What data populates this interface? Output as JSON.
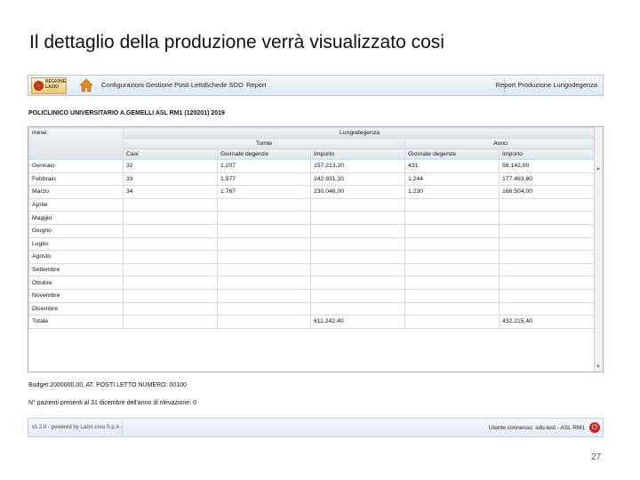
{
  "slide": {
    "title": "Il dettaglio della produzione verrà visualizzato cosi",
    "page_number": "27"
  },
  "app": {
    "logo_text": "REGIONE LAZIO",
    "menu": [
      "Configurazioni",
      "Gestione Posti Letto",
      "Schede SDO",
      "Report"
    ],
    "report_title": "Report Produzione Lungodegenza"
  },
  "hospital_header": "POLICLINICO UNIVERSITARIO A.GEMELLI ASL RM1 (120201) 2019",
  "table": {
    "col_mese": "mese",
    "group_title": "Lungodegenza",
    "sub_tomie": "Tomie",
    "sub_anno": "Anno",
    "headers": [
      "Casi",
      "Giornate degenze",
      "Importo",
      "Giornate degenze",
      "Importo"
    ],
    "rows": [
      {
        "mese": "Gennaio",
        "casi": "32",
        "gg1": "1.207",
        "imp1": "157.213,20",
        "gg2": "431",
        "imp2": "56.142,00"
      },
      {
        "mese": "Febbraio",
        "casi": "33",
        "gg1": "1.577",
        "imp1": "242.931,20",
        "gg2": "1.244",
        "imp2": "177.463,80"
      },
      {
        "mese": "Marzo",
        "casi": "34",
        "gg1": "1.767",
        "imp1": "230.046,00",
        "gg2": "1.230",
        "imp2": "166.504,00"
      },
      {
        "mese": "Aprile",
        "casi": "",
        "gg1": "",
        "imp1": "",
        "gg2": "",
        "imp2": ""
      },
      {
        "mese": "Maggio",
        "casi": "",
        "gg1": "",
        "imp1": "",
        "gg2": "",
        "imp2": ""
      },
      {
        "mese": "Giugno",
        "casi": "",
        "gg1": "",
        "imp1": "",
        "gg2": "",
        "imp2": ""
      },
      {
        "mese": "Luglio",
        "casi": "",
        "gg1": "",
        "imp1": "",
        "gg2": "",
        "imp2": ""
      },
      {
        "mese": "Agosto",
        "casi": "",
        "gg1": "",
        "imp1": "",
        "gg2": "",
        "imp2": ""
      },
      {
        "mese": "Settembre",
        "casi": "",
        "gg1": "",
        "imp1": "",
        "gg2": "",
        "imp2": ""
      },
      {
        "mese": "Ottobre",
        "casi": "",
        "gg1": "",
        "imp1": "",
        "gg2": "",
        "imp2": ""
      },
      {
        "mese": "Novembre",
        "casi": "",
        "gg1": "",
        "imp1": "",
        "gg2": "",
        "imp2": ""
      },
      {
        "mese": "Dicembre",
        "casi": "",
        "gg1": "",
        "imp1": "",
        "gg2": "",
        "imp2": ""
      },
      {
        "mese": "Totale",
        "casi": "",
        "gg1": "",
        "imp1": "611.242,40",
        "gg2": "",
        "imp2": "432.215,40"
      }
    ]
  },
  "budget_text": "Budget 2000000,00, AT. POSTI LETTO NUMERO: 00100",
  "patients_text": "N° pazienti presenti al 31 dicembre dell'anno di rilevazione: 0",
  "footer": {
    "version": "v1.2.0 - powered by Lazio crea S.p.A.",
    "user": "Utente connesso: sdo.test - ASL RM1"
  },
  "colors": {
    "toolbar_bg": "#dfe8f3",
    "grid_border": "#9fb2c9",
    "logout": "#c62828"
  }
}
